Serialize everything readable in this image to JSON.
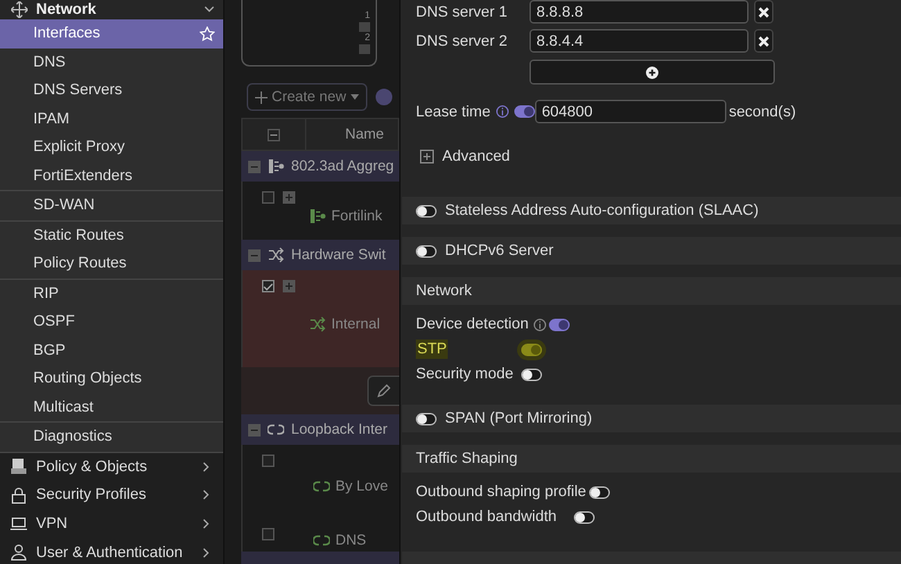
{
  "sidebar": {
    "section": {
      "label": "Network",
      "expanded": true
    },
    "groups": [
      {
        "items": [
          {
            "label": "Interfaces",
            "selected": true
          },
          {
            "label": "DNS",
            "selected": false
          },
          {
            "label": "DNS Servers",
            "selected": false
          },
          {
            "label": "IPAM",
            "selected": false
          },
          {
            "label": "Explicit Proxy",
            "selected": false
          },
          {
            "label": "FortiExtenders",
            "selected": false
          }
        ]
      },
      {
        "items": [
          {
            "label": "SD-WAN",
            "selected": false
          }
        ]
      },
      {
        "items": [
          {
            "label": "Static Routes",
            "selected": false
          },
          {
            "label": "Policy Routes",
            "selected": false
          }
        ]
      },
      {
        "items": [
          {
            "label": "RIP",
            "selected": false
          },
          {
            "label": "OSPF",
            "selected": false
          },
          {
            "label": "BGP",
            "selected": false
          },
          {
            "label": "Routing Objects",
            "selected": false
          },
          {
            "label": "Multicast",
            "selected": false
          }
        ]
      },
      {
        "items": [
          {
            "label": "Diagnostics",
            "selected": false
          }
        ]
      }
    ],
    "menus": [
      {
        "kind": "policy",
        "label": "Policy & Objects"
      },
      {
        "kind": "security",
        "label": "Security Profiles"
      },
      {
        "kind": "vpn",
        "label": "VPN"
      },
      {
        "kind": "user",
        "label": "User & Authentication"
      }
    ]
  },
  "interfaces": {
    "ports": [
      "1",
      "2"
    ],
    "create_button": "Create new",
    "select_all_indeterminate": true,
    "columns": [
      "Name"
    ],
    "rows": [
      {
        "kind": "group",
        "label": "802.3ad Aggreg",
        "expanded": true
      },
      {
        "kind": "item",
        "label": "Fortilink",
        "checked": false,
        "selected": false
      },
      {
        "kind": "group",
        "label": "Hardware Swit",
        "expanded": true
      },
      {
        "kind": "item",
        "label": "Internal",
        "checked": true,
        "selected": true
      },
      {
        "kind": "actions"
      },
      {
        "kind": "group",
        "label": "Loopback Inter",
        "expanded": true
      },
      {
        "kind": "item",
        "label": "By Love",
        "checked": false,
        "selected": false
      },
      {
        "kind": "item",
        "label": "DNS",
        "checked": false,
        "selected": false
      }
    ]
  },
  "settings": {
    "dns_servers": [
      {
        "label": "DNS server 1",
        "value": "8.8.8.8"
      },
      {
        "label": "DNS server 2",
        "value": "8.8.4.4"
      }
    ],
    "lease_time": {
      "label": "Lease time",
      "on": true,
      "value": "604800",
      "unit": "second(s)"
    },
    "advanced": {
      "label": "Advanced",
      "expanded": false
    },
    "sections": [
      {
        "kind": "toggle_header",
        "label": "Stateless Address Auto-configuration (SLAAC)",
        "on": false
      },
      {
        "kind": "toggle_header",
        "label": "DHCPv6 Server",
        "on": false
      },
      {
        "kind": "group",
        "title": "Network",
        "rows": [
          {
            "label": "Device detection",
            "info": true,
            "on": true,
            "highlighted": false
          },
          {
            "label": "STP",
            "info": false,
            "on": true,
            "highlighted": true
          },
          {
            "label": "Security mode",
            "info": false,
            "on": false,
            "highlighted": false
          }
        ]
      },
      {
        "kind": "toggle_header",
        "label": "SPAN (Port Mirroring)",
        "on": false
      },
      {
        "kind": "group",
        "title": "Traffic Shaping",
        "rows": [
          {
            "label": "Outbound shaping profile",
            "info": false,
            "on": false,
            "highlighted": false
          },
          {
            "label": "Outbound bandwidth",
            "info": false,
            "on": false,
            "highlighted": false
          }
        ]
      }
    ]
  }
}
